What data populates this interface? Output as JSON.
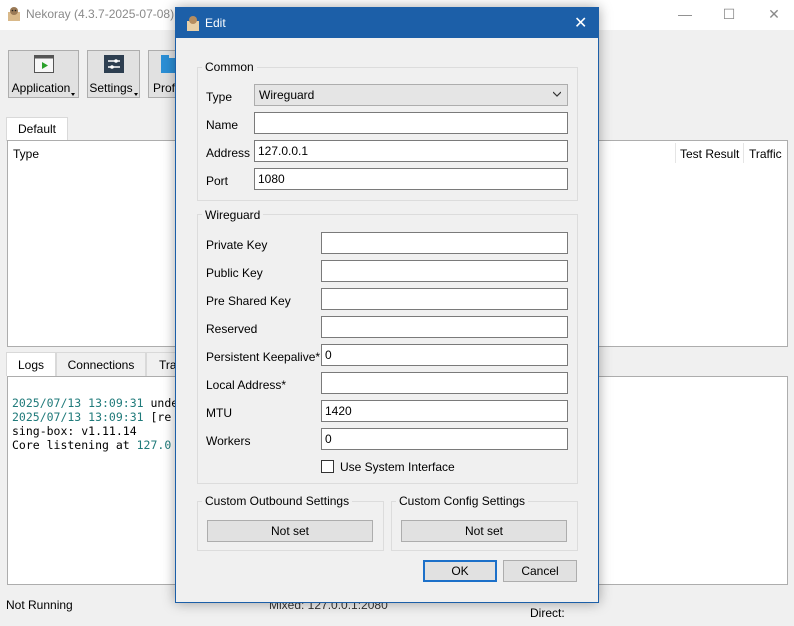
{
  "main_window": {
    "title": "Nekoray (4.3.7-2025-07-08)",
    "controls": {
      "minimize": "—",
      "maximize": "☐",
      "close": "✕"
    },
    "toolbar": [
      {
        "label": "Application",
        "icon": "play-window-icon"
      },
      {
        "label": "Settings",
        "icon": "settings-panel-icon"
      },
      {
        "label": "Prof",
        "icon": "folder-icon"
      }
    ],
    "group_tab": "Default",
    "profile_columns": [
      "Type",
      "Test Result",
      "Traffic"
    ],
    "log_tabs": [
      "Logs",
      "Connections",
      "Tra"
    ],
    "log_lines": [
      {
        "ts": "2025/07/13 13:09:31",
        "text": " unde"
      },
      {
        "ts": "2025/07/13 13:09:31",
        "text": " [re"
      },
      {
        "ts": "",
        "text": "sing-box: v1.11.14"
      },
      {
        "ts": "",
        "text": "Core listening at ",
        "ip": "127.0"
      }
    ],
    "status": {
      "left": "Not Running",
      "mid": "Mixed: 127.0.0.1:2080",
      "right": "Direct:"
    }
  },
  "dialog": {
    "title": "Edit",
    "close": "✕",
    "common": {
      "title": "Common",
      "type_label": "Type",
      "type_value": "Wireguard",
      "name_label": "Name",
      "name_value": "",
      "address_label": "Address",
      "address_value": "127.0.0.1",
      "port_label": "Port",
      "port_value": "1080"
    },
    "wireguard": {
      "title": "Wireguard",
      "fields": [
        {
          "label": "Private Key",
          "value": ""
        },
        {
          "label": "Public Key",
          "value": ""
        },
        {
          "label": "Pre Shared Key",
          "value": ""
        },
        {
          "label": "Reserved",
          "value": ""
        },
        {
          "label": "Persistent Keepalive*",
          "value": "0"
        },
        {
          "label": "Local Address*",
          "value": ""
        },
        {
          "label": "MTU",
          "value": "1420"
        },
        {
          "label": "Workers",
          "value": "0"
        }
      ],
      "use_system_interface": "Use System Interface"
    },
    "custom_outbound": {
      "title": "Custom Outbound Settings",
      "button": "Not set"
    },
    "custom_config": {
      "title": "Custom Config Settings",
      "button": "Not set"
    },
    "ok": "OK",
    "cancel": "Cancel"
  }
}
